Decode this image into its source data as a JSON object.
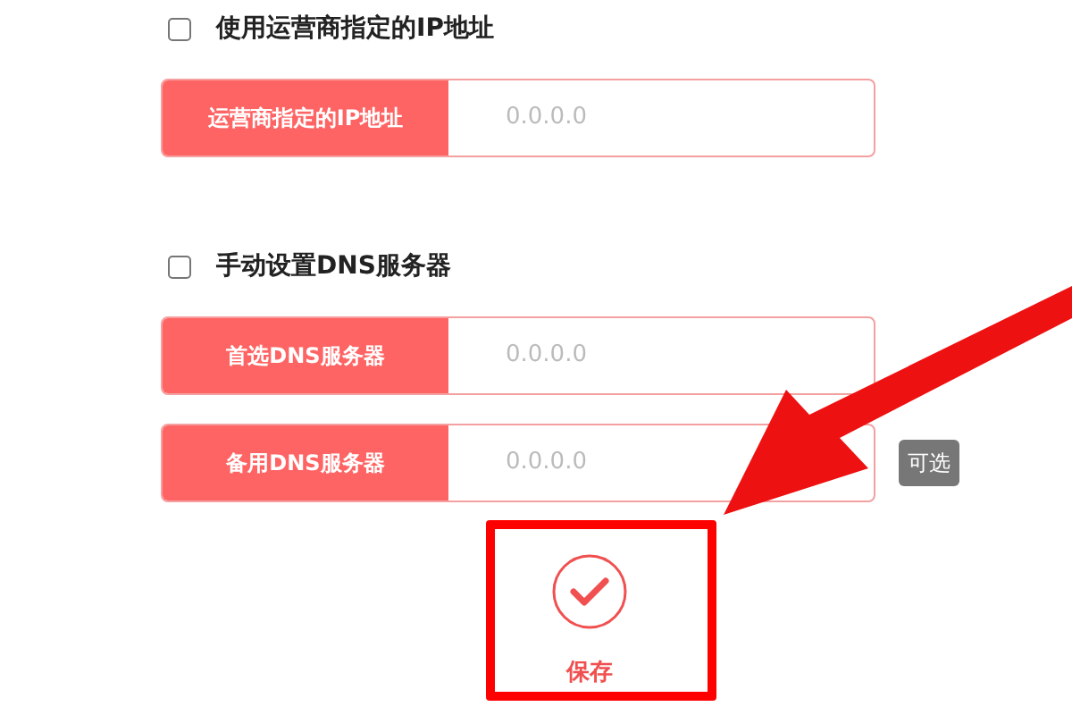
{
  "sections": [
    {
      "checkbox": {
        "label": "使用运营商指定的IP地址",
        "checked": false
      },
      "fields": [
        {
          "label": "运营商指定的IP地址",
          "placeholder": "0.0.0.0"
        }
      ]
    },
    {
      "checkbox": {
        "label": "手动设置DNS服务器",
        "checked": false
      },
      "fields": [
        {
          "label": "首选DNS服务器",
          "placeholder": "0.0.0.0"
        },
        {
          "label": "备用DNS服务器",
          "placeholder": "0.0.0.0",
          "badge": "可选"
        }
      ]
    }
  ],
  "save_button": {
    "label": "保存"
  }
}
